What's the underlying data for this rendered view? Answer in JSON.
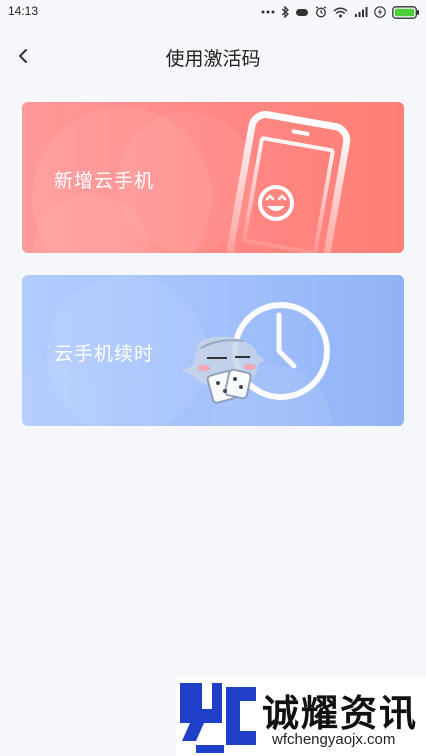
{
  "status_bar": {
    "time": "14:13",
    "icons": [
      "more-dots-icon",
      "bluetooth-icon",
      "cloud-icon",
      "alarm-icon",
      "wifi-icon",
      "signal-icon",
      "charging-icon",
      "battery-icon"
    ]
  },
  "nav": {
    "title": "使用激活码",
    "back_icon": "chevron-left-icon"
  },
  "cards": [
    {
      "label": "新增云手机",
      "icon": "smiling-phone-icon",
      "color_start": "#ff9a9a",
      "color_end": "#ff7f76"
    },
    {
      "label": "云手机续时",
      "icon": "clock-icon",
      "color_start": "#b3ccff",
      "color_end": "#8fb3f6"
    }
  ],
  "watermark": {
    "name": "诚耀资讯",
    "url": "wfchengyaojx.com",
    "color": "#1f3fc8"
  }
}
